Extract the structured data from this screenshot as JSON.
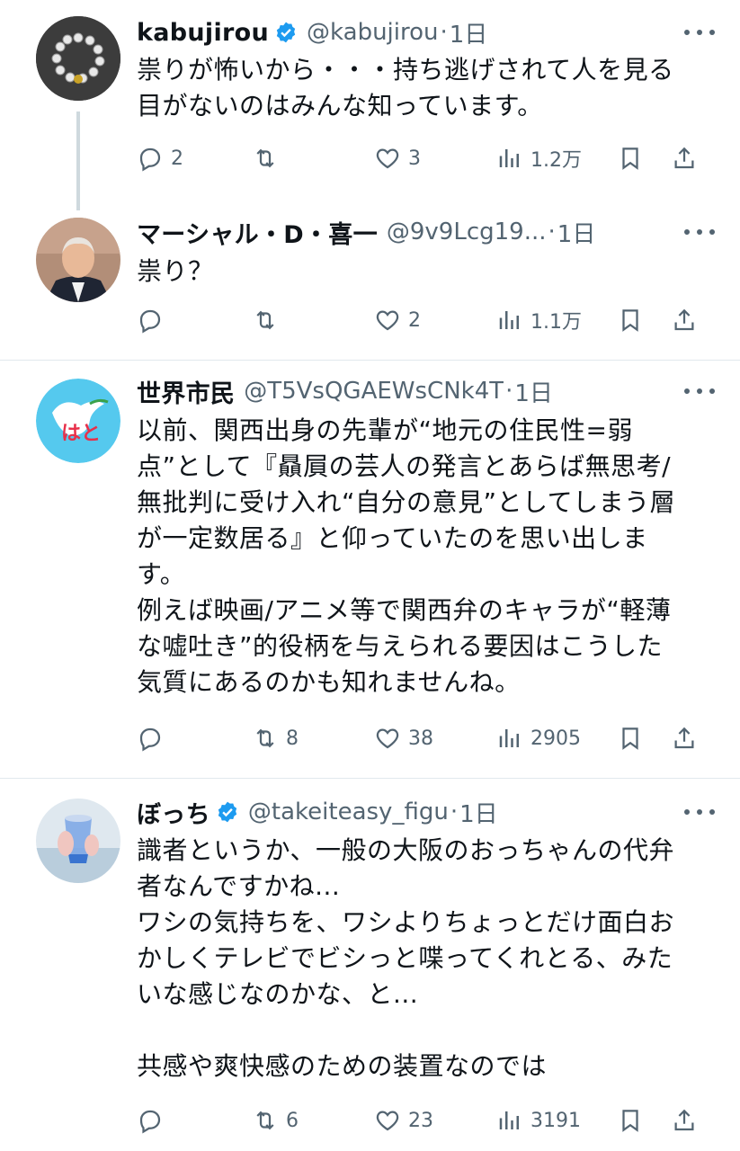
{
  "tweets": [
    {
      "name": "kabujirou",
      "verified": true,
      "handle": "@kabujirou",
      "time": "1日",
      "text": "祟りが怖いから・・・持ち逃げされて人を見る\n目がないのはみんな知っています。",
      "replies": "2",
      "retweets": "",
      "likes": "3",
      "views": "1.2万"
    },
    {
      "name": "マーシャル・D・喜一",
      "verified": false,
      "handle": "@9v9Lcg19...",
      "time": "1日",
      "text": "祟り？",
      "replies": "",
      "retweets": "",
      "likes": "2",
      "views": "1.1万"
    },
    {
      "name": "世界市民",
      "verified": false,
      "handle": "@T5VsQGAEWsCNk4T",
      "time": "1日",
      "text": "以前、関西出身の先輩が“地元の住民性=弱\n点”として『贔屓の芸人の発言とあらば無思考/\n無批判に受け入れ“自分の意見”としてしまう層\nが一定数居る』と仰っていたのを思い出しま\nす。\n例えば映画/アニメ等で関西弁のキャラが“軽薄\nな嘘吐き”的役柄を与えられる要因はこうした\n気質にあるのかも知れませんね。",
      "avatar_text": "はと",
      "replies": "",
      "retweets": "8",
      "likes": "38",
      "views": "2905"
    },
    {
      "name": "ぼっち",
      "verified": true,
      "handle": "@takeiteasy_figu",
      "time": "1日",
      "text": "識者というか、一般の大阪のおっちゃんの代弁\n者なんですかね...\nワシの気持ちを、ワシよりちょっとだけ面白お\nかしくテレビでビシっと喋ってくれとる、みた\nいな感じなのかな、と...\n\n共感や爽快感のための装置なのでは",
      "replies": "",
      "retweets": "6",
      "likes": "23",
      "views": "3191"
    }
  ],
  "dot": "·",
  "colors": {
    "text": "#0f1419",
    "muted": "#536471",
    "verified": "#1d9bf0",
    "divider": "#e1e8ed"
  },
  "icons": [
    "reply-icon",
    "retweet-icon",
    "like-icon",
    "views-icon",
    "bookmark-icon",
    "share-icon",
    "more-icon",
    "verified-badge-icon"
  ]
}
